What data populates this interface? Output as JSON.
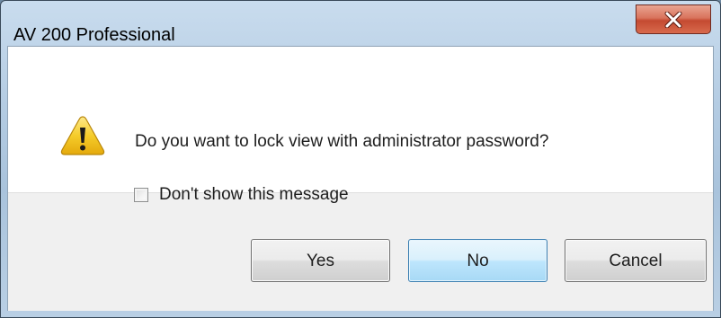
{
  "window": {
    "title": "AV 200 Professional",
    "close_label": "X"
  },
  "dialog": {
    "icon": "warning-icon",
    "message": "Do you want to lock view with administrator password?",
    "checkbox": {
      "label": "Don't show this message",
      "checked": false
    },
    "buttons": {
      "yes": "Yes",
      "no": "No",
      "cancel": "Cancel"
    },
    "default_button": "No"
  },
  "colors": {
    "close_button": "#c44a31",
    "warning_yellow": "#f2c318",
    "default_button_border": "#3c7fb1"
  }
}
